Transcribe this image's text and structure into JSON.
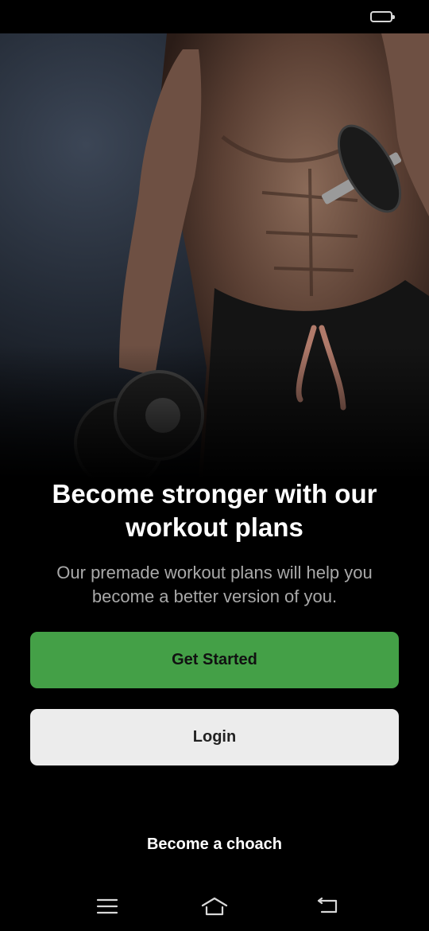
{
  "hero": {
    "icon": "muscular-man-with-dumbbells-photo"
  },
  "headline": "Become stronger with our workout plans",
  "subtext": "Our premade workout plans will help you become a better version of you.",
  "buttons": {
    "primary": "Get Started",
    "secondary": "Login"
  },
  "coach_link": "Become a choach",
  "colors": {
    "primary": "#44a047",
    "secondary": "#ececec",
    "background": "#000000"
  },
  "nav": {
    "menu": "menu-icon",
    "home": "home-icon",
    "back": "back-icon"
  }
}
